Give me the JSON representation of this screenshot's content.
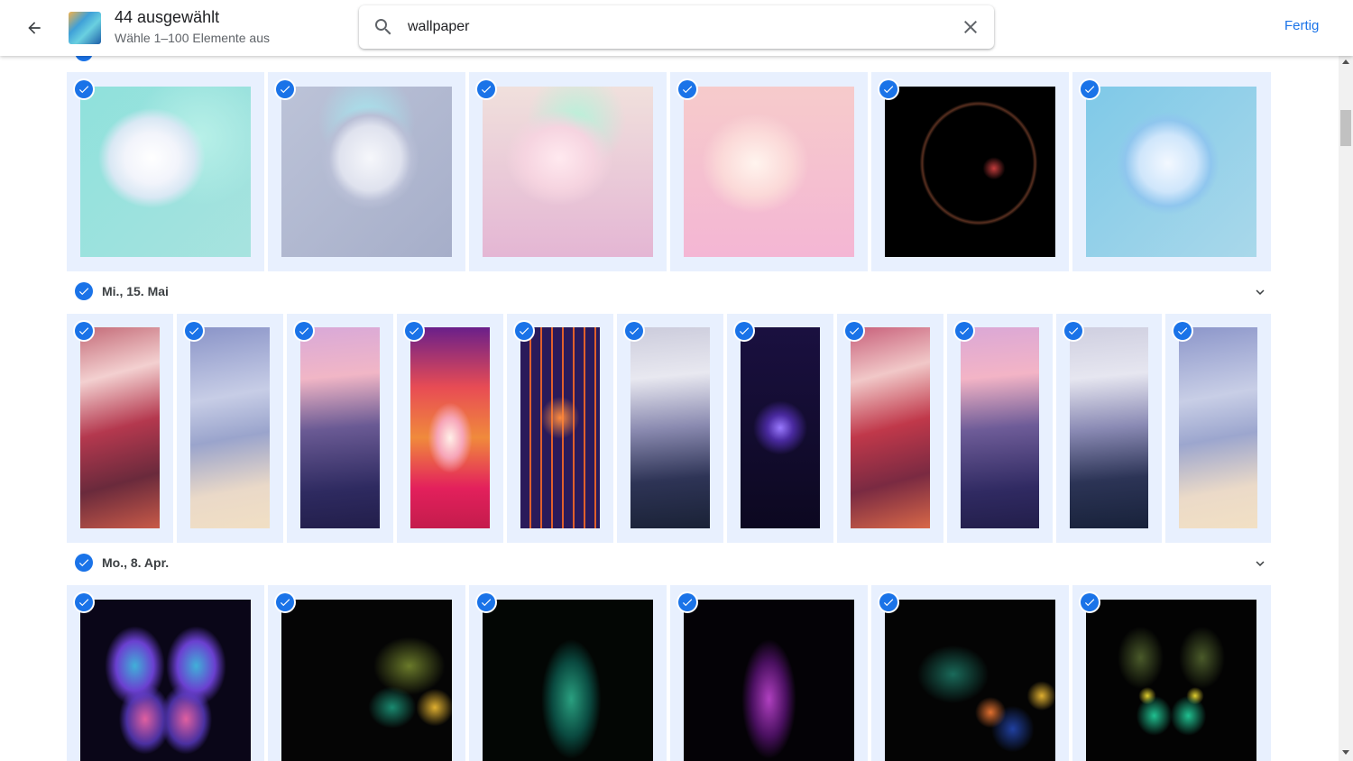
{
  "header": {
    "title": "44 ausgewählt",
    "subtitle": "Wähle 1–100 Elemente aus",
    "done_label": "Fertig"
  },
  "search": {
    "value": "wallpaper"
  },
  "sections": [
    {
      "date": "Mi., 15. Mai"
    },
    {
      "date": "Mo., 8. Apr."
    }
  ],
  "colors": {
    "accent": "#1a73e8",
    "selection_bg": "#e8f0fe"
  },
  "icons": [
    "back-arrow-icon",
    "search-icon",
    "close-icon",
    "check-circle-icon",
    "chevron-down-icon"
  ]
}
